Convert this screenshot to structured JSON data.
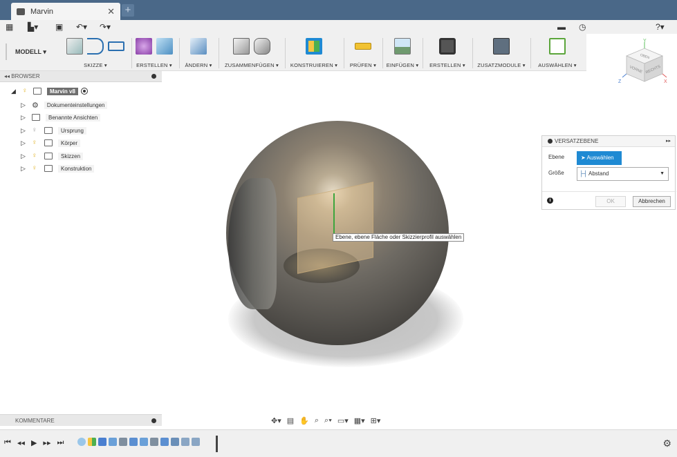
{
  "window": {
    "tab_title": "Marvin",
    "new_tab_symbol": "+"
  },
  "toolbar": {
    "workspace": "MODELL ▾",
    "groups": [
      {
        "label": "SKIZZE ▾"
      },
      {
        "label": "ERSTELLEN ▾"
      },
      {
        "label": "ÄNDERN ▾"
      },
      {
        "label": "ZUSAMMENFÜGEN ▾"
      },
      {
        "label": "KONSTRUIEREN ▾"
      },
      {
        "label": "PRÜFEN ▾"
      },
      {
        "label": "EINFÜGEN ▾"
      },
      {
        "label": "ERSTELLEN ▾"
      },
      {
        "label": "ZUSATZMODULE ▾"
      },
      {
        "label": "AUSWÄHLEN ▾"
      }
    ]
  },
  "browser": {
    "title": "BROWSER",
    "root": "Marvin v8",
    "items": [
      {
        "label": "Dokumenteinstellungen",
        "icon": "gear-icon"
      },
      {
        "label": "Benannte Ansichten",
        "icon": "folder-icon"
      },
      {
        "label": "Ursprung",
        "icon": "folder-icon"
      },
      {
        "label": "Körper",
        "icon": "folder-icon"
      },
      {
        "label": "Skizzen",
        "icon": "folder-icon"
      },
      {
        "label": "Konstruktion",
        "icon": "folder-icon"
      }
    ]
  },
  "viewcube": {
    "top": "OBEN",
    "front": "VORNE",
    "right": "RECHTS",
    "axis_x": "X",
    "axis_y": "Y",
    "axis_z": "Z"
  },
  "viewport": {
    "tooltip": "Ebene, ebene Fläche oder Skizzierprofil auswählen"
  },
  "dialog": {
    "title": "VERSATZEBENE",
    "row1_label": "Ebene",
    "select_button": "Auswählen",
    "row2_label": "Größe",
    "dropdown_value": "Abstand",
    "ok": "OK",
    "cancel": "Abbrechen"
  },
  "comments": {
    "title": "KOMMENTARE"
  },
  "colors": {
    "title_bar": "#4a6888",
    "accent_blue": "#1f8ad3",
    "toolbar_bg": "#f0f0f0"
  }
}
